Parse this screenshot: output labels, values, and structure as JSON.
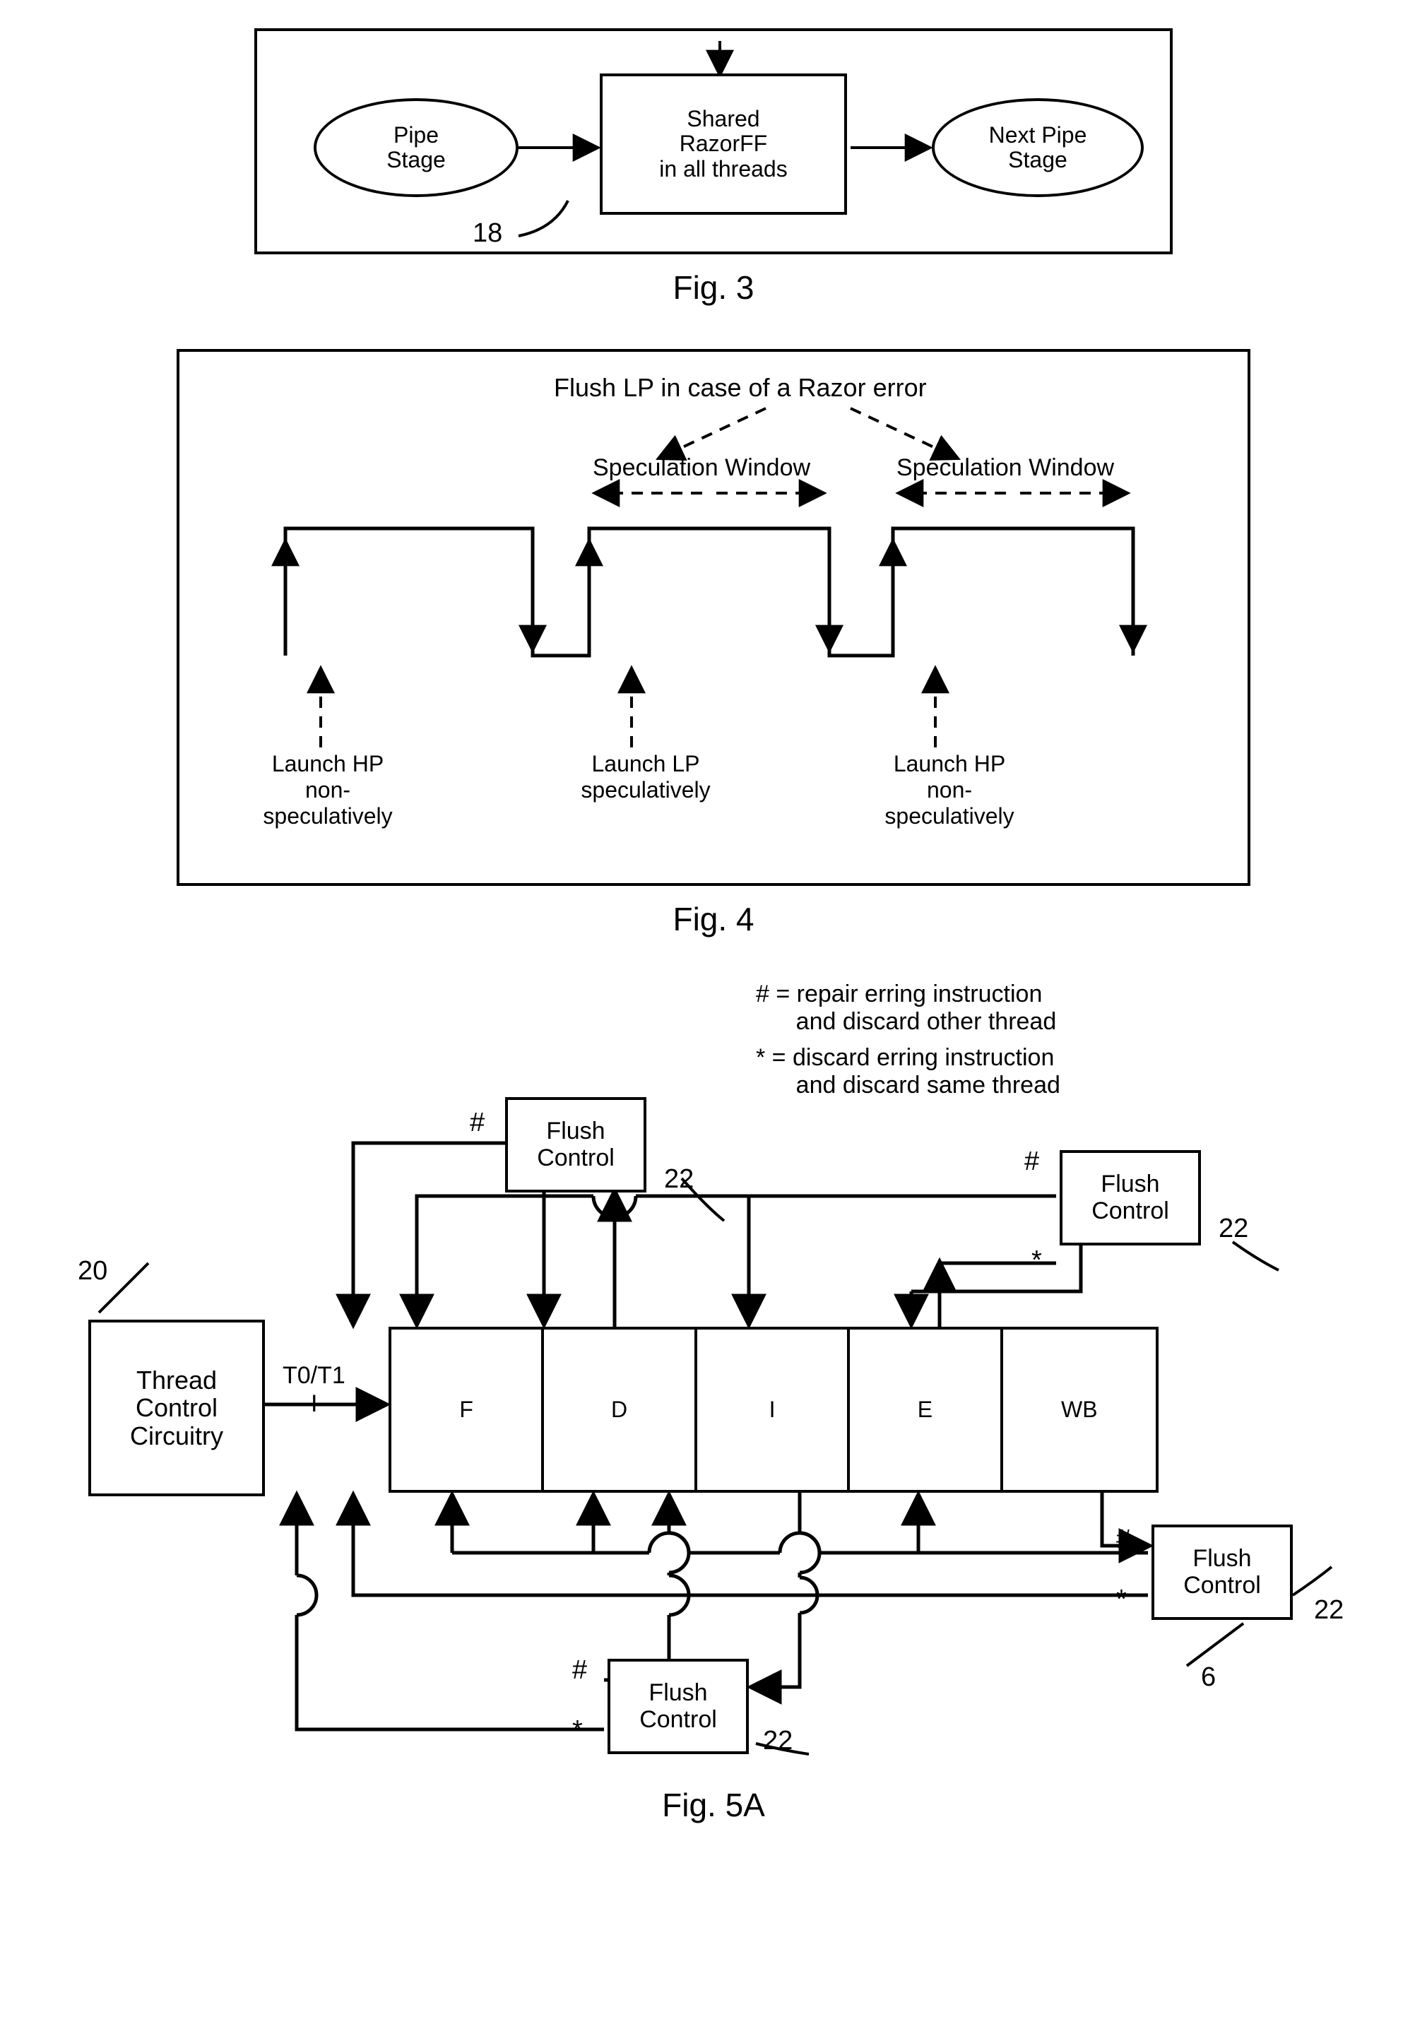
{
  "fig3": {
    "caption": "Fig. 3",
    "pipeStage": "Pipe\nStage",
    "sharedFF": "Shared\nRazorFF\nin all threads",
    "nextPipeStage": "Next Pipe\nStage",
    "ref18": "18"
  },
  "fig4": {
    "caption": "Fig. 4",
    "flushTitle": "Flush LP in case of a Razor error",
    "specWindow": "Speculation Window",
    "launchHPnon": "Launch HP\nnon-\nspeculatively",
    "launchLPspec": "Launch LP\nspeculatively",
    "launchHPnon2": "Launch HP\nnon-\nspeculatively"
  },
  "fig5": {
    "caption": "Fig. 5A",
    "legendHash": "# = repair erring instruction\n      and discard other thread",
    "legendStar": "* = discard erring instruction\n      and discard same thread",
    "flushControl": "Flush\nControl",
    "threadControl": "Thread\nControl\nCircuitry",
    "t0t1": "T0/T1",
    "I": "I",
    "stages": [
      "F",
      "D",
      "I",
      "E",
      "WB"
    ],
    "hash": "#",
    "star": "*",
    "ref20": "20",
    "ref22": "22",
    "ref6": "6"
  }
}
